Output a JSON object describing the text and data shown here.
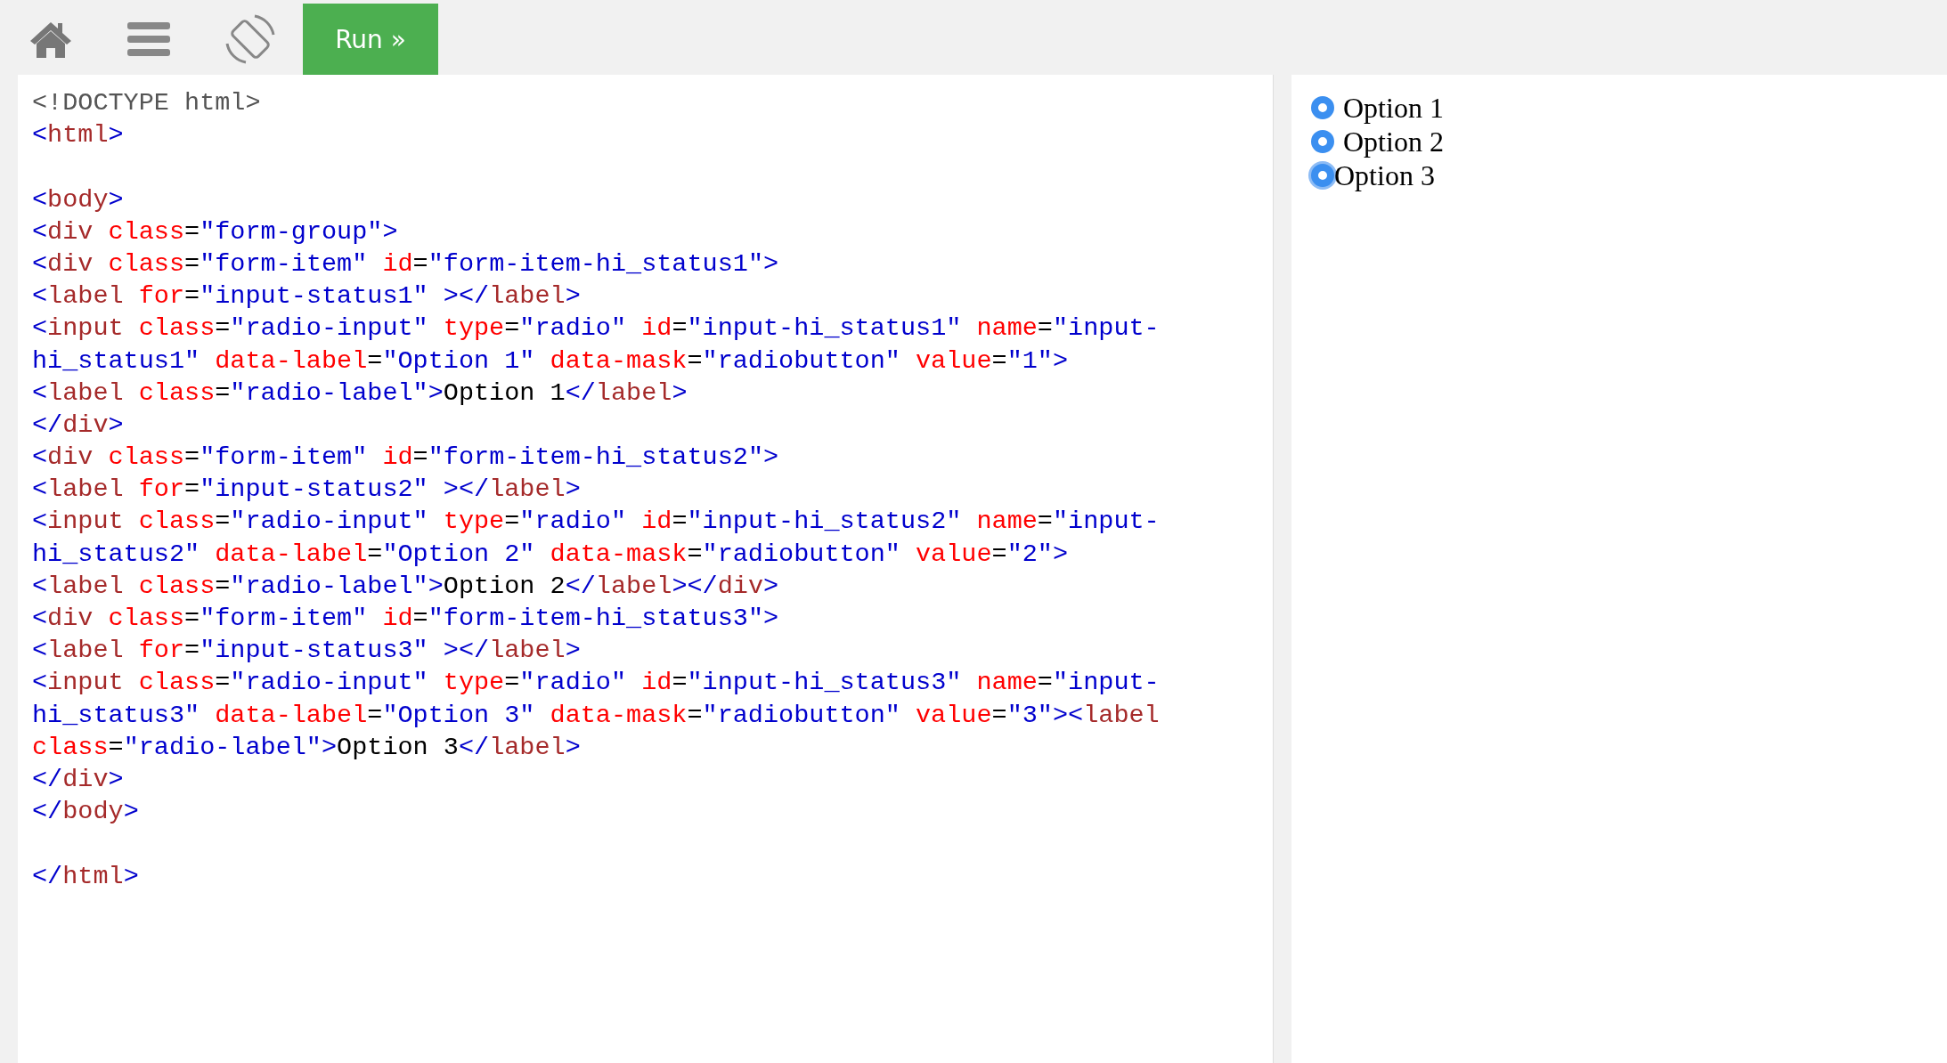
{
  "toolbar": {
    "run_button": "Run »"
  },
  "code_editor": {
    "lines": [
      {
        "kind": "code",
        "segments": [
          {
            "kind": "doctype",
            "text": "<!DOCTYPE html>"
          }
        ]
      },
      {
        "kind": "code",
        "segments": [
          {
            "kind": "bracket",
            "text": "<"
          },
          {
            "kind": "tag",
            "text": "html"
          },
          {
            "kind": "bracket",
            "text": ">"
          }
        ]
      },
      {
        "kind": "blank"
      },
      {
        "kind": "code",
        "segments": [
          {
            "kind": "bracket",
            "text": "<"
          },
          {
            "kind": "tag",
            "text": "body"
          },
          {
            "kind": "bracket",
            "text": ">"
          }
        ]
      },
      {
        "kind": "code",
        "segments": [
          {
            "kind": "bracket",
            "text": "<"
          },
          {
            "kind": "tag",
            "text": "div"
          },
          {
            "kind": "attr",
            "text": " class"
          },
          {
            "kind": "eq",
            "text": "="
          },
          {
            "kind": "value",
            "text": "\"form-group\""
          },
          {
            "kind": "bracket",
            "text": ">"
          }
        ]
      },
      {
        "kind": "code",
        "segments": [
          {
            "kind": "bracket",
            "text": "<"
          },
          {
            "kind": "tag",
            "text": "div"
          },
          {
            "kind": "attr",
            "text": " class"
          },
          {
            "kind": "eq",
            "text": "="
          },
          {
            "kind": "value",
            "text": "\"form-item\""
          },
          {
            "kind": "attr",
            "text": " id"
          },
          {
            "kind": "eq",
            "text": "="
          },
          {
            "kind": "value",
            "text": "\"form-item-hi_status1\""
          },
          {
            "kind": "bracket",
            "text": ">"
          }
        ]
      },
      {
        "kind": "code",
        "segments": [
          {
            "kind": "bracket",
            "text": "<"
          },
          {
            "kind": "tag",
            "text": "label"
          },
          {
            "kind": "attr",
            "text": " for"
          },
          {
            "kind": "eq",
            "text": "="
          },
          {
            "kind": "value",
            "text": "\"input-status1\""
          },
          {
            "kind": "bracket",
            "text": " ></"
          },
          {
            "kind": "tag",
            "text": "label"
          },
          {
            "kind": "bracket",
            "text": ">"
          }
        ]
      },
      {
        "kind": "code",
        "segments": [
          {
            "kind": "bracket",
            "text": "<"
          },
          {
            "kind": "tag",
            "text": "input"
          },
          {
            "kind": "attr",
            "text": " class"
          },
          {
            "kind": "eq",
            "text": "="
          },
          {
            "kind": "value",
            "text": "\"radio-input\""
          },
          {
            "kind": "attr",
            "text": " type"
          },
          {
            "kind": "eq",
            "text": "="
          },
          {
            "kind": "value",
            "text": "\"radio\""
          },
          {
            "kind": "attr",
            "text": " id"
          },
          {
            "kind": "eq",
            "text": "="
          },
          {
            "kind": "value",
            "text": "\"input-hi_status1\""
          },
          {
            "kind": "attr",
            "text": " name"
          },
          {
            "kind": "eq",
            "text": "="
          },
          {
            "kind": "value",
            "text": "\"input-"
          }
        ]
      },
      {
        "kind": "code",
        "segments": [
          {
            "kind": "value",
            "text": "hi_status1\""
          },
          {
            "kind": "attr",
            "text": " data-label"
          },
          {
            "kind": "eq",
            "text": "="
          },
          {
            "kind": "value",
            "text": "\"Option 1\""
          },
          {
            "kind": "attr",
            "text": " data-mask"
          },
          {
            "kind": "eq",
            "text": "="
          },
          {
            "kind": "value",
            "text": "\"radiobutton\""
          },
          {
            "kind": "attr",
            "text": " value"
          },
          {
            "kind": "eq",
            "text": "="
          },
          {
            "kind": "value",
            "text": "\"1\""
          },
          {
            "kind": "bracket",
            "text": ">"
          }
        ]
      },
      {
        "kind": "code",
        "segments": [
          {
            "kind": "bracket",
            "text": "<"
          },
          {
            "kind": "tag",
            "text": "label"
          },
          {
            "kind": "attr",
            "text": " class"
          },
          {
            "kind": "eq",
            "text": "="
          },
          {
            "kind": "value",
            "text": "\"radio-label\""
          },
          {
            "kind": "bracket",
            "text": ">"
          },
          {
            "kind": "text",
            "text": "Option 1"
          },
          {
            "kind": "bracket",
            "text": "</"
          },
          {
            "kind": "tag",
            "text": "label"
          },
          {
            "kind": "bracket",
            "text": ">"
          }
        ]
      },
      {
        "kind": "code",
        "segments": [
          {
            "kind": "bracket",
            "text": "</"
          },
          {
            "kind": "tag",
            "text": "div"
          },
          {
            "kind": "bracket",
            "text": ">"
          }
        ]
      },
      {
        "kind": "code",
        "segments": [
          {
            "kind": "bracket",
            "text": "<"
          },
          {
            "kind": "tag",
            "text": "div"
          },
          {
            "kind": "attr",
            "text": " class"
          },
          {
            "kind": "eq",
            "text": "="
          },
          {
            "kind": "value",
            "text": "\"form-item\""
          },
          {
            "kind": "attr",
            "text": " id"
          },
          {
            "kind": "eq",
            "text": "="
          },
          {
            "kind": "value",
            "text": "\"form-item-hi_status2\""
          },
          {
            "kind": "bracket",
            "text": ">"
          }
        ]
      },
      {
        "kind": "code",
        "segments": [
          {
            "kind": "bracket",
            "text": "<"
          },
          {
            "kind": "tag",
            "text": "label"
          },
          {
            "kind": "attr",
            "text": " for"
          },
          {
            "kind": "eq",
            "text": "="
          },
          {
            "kind": "value",
            "text": "\"input-status2\""
          },
          {
            "kind": "bracket",
            "text": " ></"
          },
          {
            "kind": "tag",
            "text": "label"
          },
          {
            "kind": "bracket",
            "text": ">"
          }
        ]
      },
      {
        "kind": "code",
        "segments": [
          {
            "kind": "bracket",
            "text": "<"
          },
          {
            "kind": "tag",
            "text": "input"
          },
          {
            "kind": "attr",
            "text": " class"
          },
          {
            "kind": "eq",
            "text": "="
          },
          {
            "kind": "value",
            "text": "\"radio-input\""
          },
          {
            "kind": "attr",
            "text": " type"
          },
          {
            "kind": "eq",
            "text": "="
          },
          {
            "kind": "value",
            "text": "\"radio\""
          },
          {
            "kind": "attr",
            "text": " id"
          },
          {
            "kind": "eq",
            "text": "="
          },
          {
            "kind": "value",
            "text": "\"input-hi_status2\""
          },
          {
            "kind": "attr",
            "text": " name"
          },
          {
            "kind": "eq",
            "text": "="
          },
          {
            "kind": "value",
            "text": "\"input-"
          }
        ]
      },
      {
        "kind": "code",
        "segments": [
          {
            "kind": "value",
            "text": "hi_status2\""
          },
          {
            "kind": "attr",
            "text": " data-label"
          },
          {
            "kind": "eq",
            "text": "="
          },
          {
            "kind": "value",
            "text": "\"Option 2\""
          },
          {
            "kind": "attr",
            "text": " data-mask"
          },
          {
            "kind": "eq",
            "text": "="
          },
          {
            "kind": "value",
            "text": "\"radiobutton\""
          },
          {
            "kind": "attr",
            "text": " value"
          },
          {
            "kind": "eq",
            "text": "="
          },
          {
            "kind": "value",
            "text": "\"2\""
          },
          {
            "kind": "bracket",
            "text": ">"
          }
        ]
      },
      {
        "kind": "code",
        "segments": [
          {
            "kind": "bracket",
            "text": "<"
          },
          {
            "kind": "tag",
            "text": "label"
          },
          {
            "kind": "attr",
            "text": " class"
          },
          {
            "kind": "eq",
            "text": "="
          },
          {
            "kind": "value",
            "text": "\"radio-label\""
          },
          {
            "kind": "bracket",
            "text": ">"
          },
          {
            "kind": "text",
            "text": "Option 2"
          },
          {
            "kind": "bracket",
            "text": "</"
          },
          {
            "kind": "tag",
            "text": "label"
          },
          {
            "kind": "bracket",
            "text": "></"
          },
          {
            "kind": "tag",
            "text": "div"
          },
          {
            "kind": "bracket",
            "text": ">"
          }
        ]
      },
      {
        "kind": "code",
        "segments": [
          {
            "kind": "bracket",
            "text": "<"
          },
          {
            "kind": "tag",
            "text": "div"
          },
          {
            "kind": "attr",
            "text": " class"
          },
          {
            "kind": "eq",
            "text": "="
          },
          {
            "kind": "value",
            "text": "\"form-item\""
          },
          {
            "kind": "attr",
            "text": " id"
          },
          {
            "kind": "eq",
            "text": "="
          },
          {
            "kind": "value",
            "text": "\"form-item-hi_status3\""
          },
          {
            "kind": "bracket",
            "text": ">"
          }
        ]
      },
      {
        "kind": "code",
        "segments": [
          {
            "kind": "bracket",
            "text": "<"
          },
          {
            "kind": "tag",
            "text": "label"
          },
          {
            "kind": "attr",
            "text": " for"
          },
          {
            "kind": "eq",
            "text": "="
          },
          {
            "kind": "value",
            "text": "\"input-status3\""
          },
          {
            "kind": "bracket",
            "text": " ></"
          },
          {
            "kind": "tag",
            "text": "label"
          },
          {
            "kind": "bracket",
            "text": ">"
          }
        ]
      },
      {
        "kind": "code",
        "segments": [
          {
            "kind": "bracket",
            "text": "<"
          },
          {
            "kind": "tag",
            "text": "input"
          },
          {
            "kind": "attr",
            "text": " class"
          },
          {
            "kind": "eq",
            "text": "="
          },
          {
            "kind": "value",
            "text": "\"radio-input\""
          },
          {
            "kind": "attr",
            "text": " type"
          },
          {
            "kind": "eq",
            "text": "="
          },
          {
            "kind": "value",
            "text": "\"radio\""
          },
          {
            "kind": "attr",
            "text": " id"
          },
          {
            "kind": "eq",
            "text": "="
          },
          {
            "kind": "value",
            "text": "\"input-hi_status3\""
          },
          {
            "kind": "attr",
            "text": " name"
          },
          {
            "kind": "eq",
            "text": "="
          },
          {
            "kind": "value",
            "text": "\"input-"
          }
        ]
      },
      {
        "kind": "code",
        "segments": [
          {
            "kind": "value",
            "text": "hi_status3\""
          },
          {
            "kind": "attr",
            "text": " data-label"
          },
          {
            "kind": "eq",
            "text": "="
          },
          {
            "kind": "value",
            "text": "\"Option 3\""
          },
          {
            "kind": "attr",
            "text": " data-mask"
          },
          {
            "kind": "eq",
            "text": "="
          },
          {
            "kind": "value",
            "text": "\"radiobutton\""
          },
          {
            "kind": "attr",
            "text": " value"
          },
          {
            "kind": "eq",
            "text": "="
          },
          {
            "kind": "value",
            "text": "\"3\""
          },
          {
            "kind": "bracket",
            "text": "><"
          },
          {
            "kind": "tag",
            "text": "label"
          }
        ]
      },
      {
        "kind": "code",
        "segments": [
          {
            "kind": "attr",
            "text": "class"
          },
          {
            "kind": "eq",
            "text": "="
          },
          {
            "kind": "value",
            "text": "\"radio-label\""
          },
          {
            "kind": "bracket",
            "text": ">"
          },
          {
            "kind": "text",
            "text": "Option 3"
          },
          {
            "kind": "bracket",
            "text": "</"
          },
          {
            "kind": "tag",
            "text": "label"
          },
          {
            "kind": "bracket",
            "text": ">"
          }
        ]
      },
      {
        "kind": "code",
        "segments": [
          {
            "kind": "bracket",
            "text": "</"
          },
          {
            "kind": "tag",
            "text": "div"
          },
          {
            "kind": "bracket",
            "text": ">"
          }
        ]
      },
      {
        "kind": "code",
        "segments": [
          {
            "kind": "bracket",
            "text": "</"
          },
          {
            "kind": "tag",
            "text": "body"
          },
          {
            "kind": "bracket",
            "text": ">"
          }
        ]
      },
      {
        "kind": "blank"
      },
      {
        "kind": "code",
        "segments": [
          {
            "kind": "bracket",
            "text": "</"
          },
          {
            "kind": "tag",
            "text": "html"
          },
          {
            "kind": "bracket",
            "text": ">"
          }
        ]
      }
    ]
  },
  "preview": {
    "options": [
      {
        "label": "Option 1",
        "selected": true,
        "focused": false
      },
      {
        "label": "Option 2",
        "selected": true,
        "focused": false
      },
      {
        "label": "Option 3",
        "selected": true,
        "focused": true
      }
    ]
  }
}
